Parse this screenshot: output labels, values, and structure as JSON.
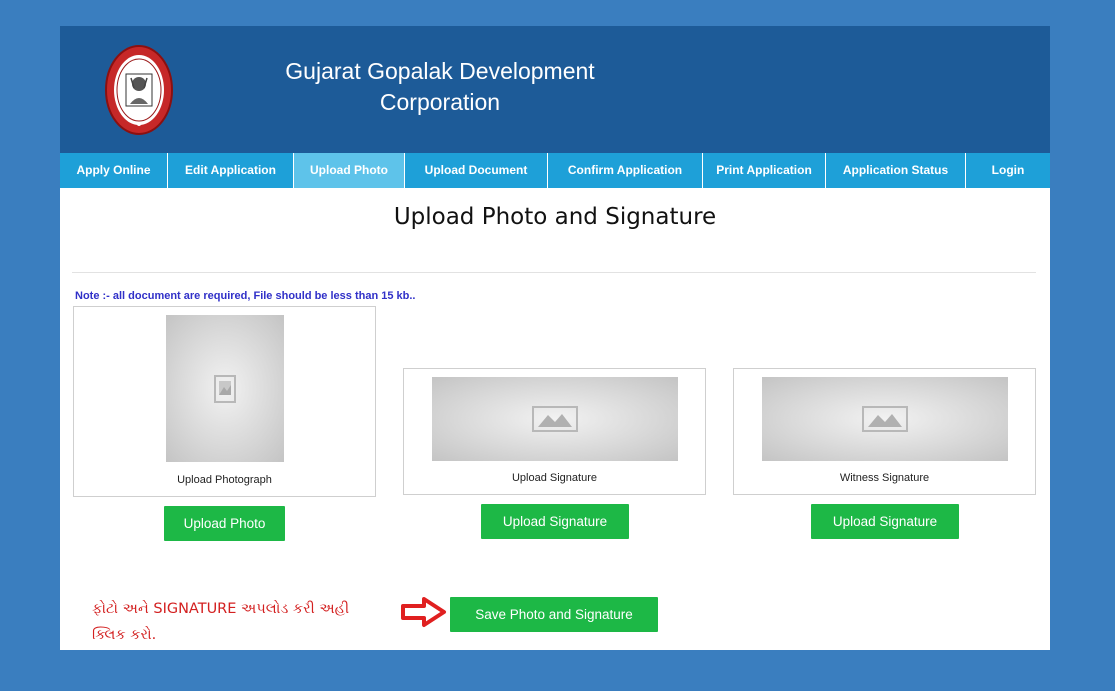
{
  "header": {
    "title_line1": "Gujarat Gopalak Development",
    "title_line2": "Corporation"
  },
  "nav": [
    {
      "label": "Apply Online",
      "active": false
    },
    {
      "label": "Edit Application",
      "active": false
    },
    {
      "label": "Upload Photo",
      "active": true
    },
    {
      "label": "Upload Document",
      "active": false
    },
    {
      "label": "Confirm Application",
      "active": false
    },
    {
      "label": "Print Application",
      "active": false
    },
    {
      "label": "Application Status",
      "active": false
    },
    {
      "label": "Login",
      "active": false
    }
  ],
  "main": {
    "heading": "Upload Photo and Signature",
    "note": "Note :- all document are required, File should be less than 15 kb..",
    "photo_caption": "Upload Photograph",
    "signature_caption": "Upload Signature",
    "witness_caption": "Witness Signature",
    "upload_photo_button": "Upload Photo",
    "upload_signature_button": "Upload Signature",
    "upload_witness_button": "Upload Signature",
    "save_button": "Save Photo and Signature",
    "instruction_line1": "ફોટો અને SIGNATURE અપલોડ કરી અહી",
    "instruction_line2": "ક્લિક કરો."
  },
  "colors": {
    "background": "#3a7ebf",
    "header": "#1d5b98",
    "nav": "#1ea0d8",
    "nav_active": "#5ec3ea",
    "button": "#1db846",
    "note": "#3030c8",
    "instruction": "#d32020"
  }
}
